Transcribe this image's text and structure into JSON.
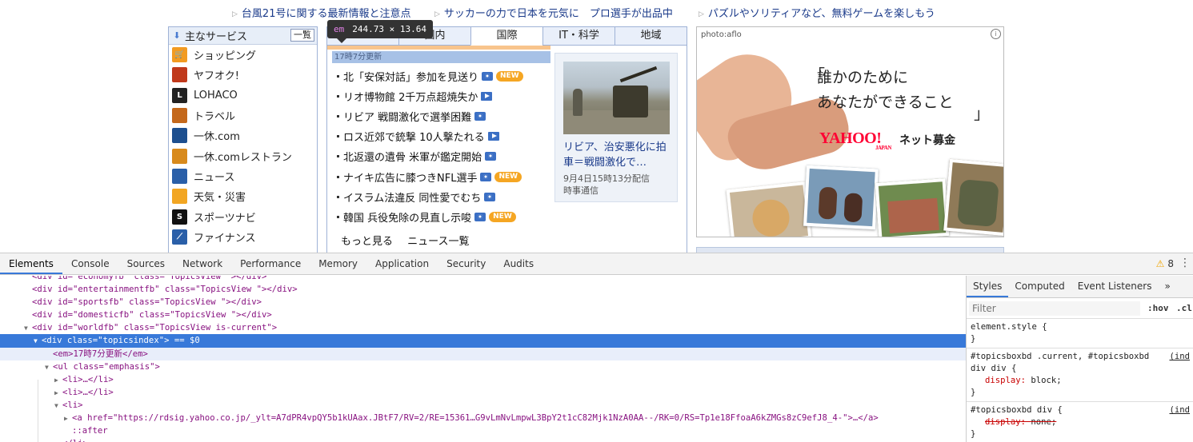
{
  "promos": [
    {
      "text": "台風21号に関する最新情報と注意点"
    },
    {
      "text": "サッカーの力で日本を元気に　プロ選手が出品中"
    },
    {
      "text": "パズルやソリティアなど、無料ゲームを楽しもう"
    }
  ],
  "services": {
    "title": "主なサービス",
    "more_label": "一覧",
    "items": [
      {
        "label": "ショッピング",
        "icon": "shopping-cart-icon",
        "color": "#f29b21"
      },
      {
        "label": "ヤフオク!",
        "icon": "auction-gavel-icon",
        "color": "#c0391b"
      },
      {
        "label": "LOHACO",
        "icon": "lohaco-icon",
        "color": "#222222"
      },
      {
        "label": "トラベル",
        "icon": "suitcase-icon",
        "color": "#c4681b"
      },
      {
        "label": "一休.com",
        "icon": "ikyu-icon",
        "color": "#1d4f8f"
      },
      {
        "label": "一休.comレストラン",
        "icon": "ikyu-restaurant-icon",
        "color": "#d88a1c"
      },
      {
        "label": "ニュース",
        "icon": "news-icon",
        "color": "#2a5fa8"
      },
      {
        "label": "天気・災害",
        "icon": "weather-sun-icon",
        "color": "#f2a623"
      },
      {
        "label": "スポーツナビ",
        "icon": "sportsnavi-icon",
        "color": "#111111"
      },
      {
        "label": "ファイナンス",
        "icon": "finance-chart-icon",
        "color": "#2a5fa8"
      }
    ]
  },
  "tooltip": {
    "tag": "em",
    "size": "244.73 × 13.64"
  },
  "news": {
    "tabs": [
      "",
      "国内",
      "国際",
      "IT・科学",
      "地域"
    ],
    "current_tab": "国際",
    "updated": "17時7分更新",
    "headlines": [
      {
        "text": "北「安保対話」参加を見送り",
        "media": "camera",
        "new": true
      },
      {
        "text": "リオ博物館 2千万点超焼失か",
        "media": "video",
        "new": false
      },
      {
        "text": "リビア 戦闘激化で選挙困難",
        "media": "camera",
        "new": false
      },
      {
        "text": "ロス近郊で銃撃 10人撃たれる",
        "media": "video",
        "new": false
      },
      {
        "text": "北返還の遺骨 米軍が鑑定開始",
        "media": "camera",
        "new": false
      },
      {
        "text": "ナイキ広告に膝つきNFL選手",
        "media": "camera",
        "new": true
      },
      {
        "text": "イスラム法違反 同性愛でむち",
        "media": "camera",
        "new": false
      },
      {
        "text": "韓国 兵役免除の見直し示唆",
        "media": "camera",
        "new": true
      }
    ],
    "new_label": "NEW",
    "more": "もっと見る",
    "list": "ニュース一覧",
    "photo": {
      "caption": "リビア、治安悪化に拍車＝戦闘激化で…",
      "date": "9月4日15時13分配信",
      "source": "時事通信"
    }
  },
  "ad": {
    "credit": "photo:aflo",
    "slogan_line1": "誰かのために",
    "slogan_line2": "あなたができること",
    "logo": "YAHOO!",
    "logo_sub": "JAPAN",
    "service": "ネット募金",
    "info_icon": "info-icon"
  },
  "devtools": {
    "tabs": [
      "Elements",
      "Console",
      "Sources",
      "Network",
      "Performance",
      "Memory",
      "Application",
      "Security",
      "Audits"
    ],
    "active_tab": "Elements",
    "warnings": "8",
    "styles_tabs": [
      "Styles",
      "Computed",
      "Event Listeners",
      "»"
    ],
    "filter_placeholder": "Filter",
    "hov": ":hov",
    "cls": ".cl",
    "dom_lines": [
      "<div id=\"economyfb\" class=\"TopicsView \"></div>",
      "<div id=\"entertainmentfb\" class=\"TopicsView \"></div>",
      "<div id=\"sportsfb\" class=\"TopicsView \"></div>",
      "<div id=\"domesticfb\" class=\"TopicsView \"></div>",
      "<div id=\"worldfb\" class=\"TopicsView is-current\">",
      "<div class=\"topicsindex\"> == $0",
      "<em>17時7分更新</em>",
      "<ul class=\"emphasis\">",
      "<li>…</li>",
      "<li>…</li>",
      "<li>",
      "<a href=\"https://rdsig.yahoo.co.jp/_ylt=A7dPR4vpQY5b1kUAax.JBtF7/RV=2/RE=15361…G9vLmNvLmpwL3BpY2t1cC82Mjk1NzA0AA--/RK=0/RS=Tp1e18FfoaA6kZMGs8zC9efJ8_4-\">…</a>",
      "::after",
      "</li>"
    ],
    "rules": [
      {
        "selector": "element.style {",
        "props": [],
        "close": "}"
      },
      {
        "selector": "#topicsboxbd .current, #topicsboxbd div div {",
        "source": "(ind",
        "props": [
          {
            "name": "display",
            "value": "block;",
            "struck": false
          }
        ],
        "close": "}"
      },
      {
        "selector": "#topicsboxbd div {",
        "source": "(ind",
        "props": [
          {
            "name": "display",
            "value": "none;",
            "struck": true
          }
        ],
        "close": "}"
      }
    ]
  }
}
